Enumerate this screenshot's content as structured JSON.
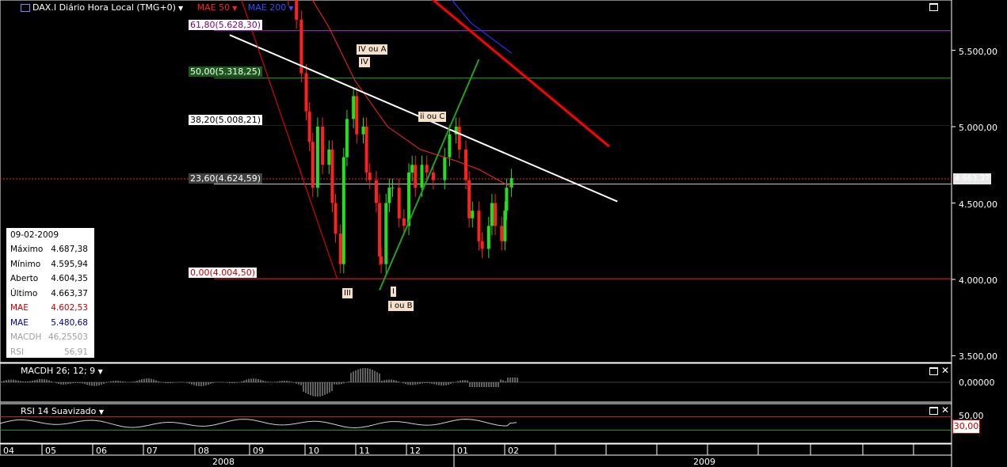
{
  "header": {
    "symbol": "DAX.I Diário Hora Local (TMG+0)",
    "mae50": "MAE 50",
    "mae200": "MAE 200"
  },
  "fib_levels": [
    {
      "label": "61,80(5.628,30)",
      "value": 5628.3,
      "color": "#a040c0"
    },
    {
      "label": "50,00(5.318,25)",
      "value": 5318.25,
      "color": "#20a020"
    },
    {
      "label": "38,20(5.008,21)",
      "value": 5008.21,
      "color": "#ffffff"
    },
    {
      "label": "23,60(4.624,59)",
      "value": 4624.59,
      "color": "#c8c8c8"
    },
    {
      "label": "0,00(4.004,50)",
      "value": 4004.5,
      "color": "#ff2020"
    }
  ],
  "wave_labels": [
    {
      "text": "IV ou A",
      "date": "2008-10-27",
      "value": 5650
    },
    {
      "text": "IV",
      "date": "2008-10-28",
      "value": 5580
    },
    {
      "text": "ii ou C",
      "date": "2009-01-06",
      "value": 5080
    },
    {
      "text": "III",
      "date": "2008-10-25",
      "value": 3940
    },
    {
      "text": "I",
      "date": "2008-11-21",
      "value": 3940
    },
    {
      "text": "i ou B",
      "date": "2008-11-21",
      "value": 3860
    }
  ],
  "price_axis": [
    "5.500,00",
    "5.000,00",
    "4.500,00",
    "4.000,00",
    "3.500,00"
  ],
  "last_price_tag": "4.663,37",
  "info_box": {
    "date": "09-02-2009",
    "rows": [
      {
        "label": "Máximo",
        "value": "4.687,38",
        "color": "#000000"
      },
      {
        "label": "Mínimo",
        "value": "4.595,94",
        "color": "#000000"
      },
      {
        "label": "Aberto",
        "value": "4.604,35",
        "color": "#000000"
      },
      {
        "label": "Último",
        "value": "4.663,37",
        "color": "#000000"
      },
      {
        "label": "MAE",
        "value": "4.602,53",
        "color": "#c00000"
      },
      {
        "label": "MAE",
        "value": "5.480,68",
        "color": "#000080"
      },
      {
        "label": "MACDH",
        "value": "46,25503",
        "color": "#a0a0a0"
      },
      {
        "label": "RSI",
        "value": "56,91",
        "color": "#a0a0a0"
      }
    ]
  },
  "macd_pane": {
    "title": "MACDH 26; 12; 9",
    "axis_label": "0,00000"
  },
  "rsi_pane": {
    "title": "RSI 14 Suavizado",
    "axis_label": "50,00",
    "badge": "30,00"
  },
  "x_axis": {
    "months": [
      "04",
      "05",
      "06",
      "07",
      "08",
      "09",
      "10",
      "11",
      "12",
      "01",
      "02"
    ],
    "years": [
      "2008",
      "2009"
    ]
  },
  "colors": {
    "bull": "#20e020",
    "bear": "#ff2020",
    "mae50": "#ff2020",
    "mae200": "#2030ff",
    "trend_white": "#ffffff",
    "trend_red": "#ff0000",
    "trend_green": "#20a020"
  },
  "chart_data": {
    "type": "candlestick",
    "title": "DAX.I Diário Hora Local (TMG+0)",
    "ylim": [
      3400,
      5900
    ],
    "series_close": [
      {
        "date": "2008-09-15",
        "value": 6050
      },
      {
        "date": "2008-09-25",
        "value": 5850
      },
      {
        "date": "2008-09-30",
        "value": 5700
      },
      {
        "date": "2008-10-03",
        "value": 5350
      },
      {
        "date": "2008-10-06",
        "value": 5100
      },
      {
        "date": "2008-10-08",
        "value": 4900
      },
      {
        "date": "2008-10-10",
        "value": 4600
      },
      {
        "date": "2008-10-13",
        "value": 5000
      },
      {
        "date": "2008-10-16",
        "value": 4750
      },
      {
        "date": "2008-10-20",
        "value": 4850
      },
      {
        "date": "2008-10-22",
        "value": 4500
      },
      {
        "date": "2008-10-24",
        "value": 4300
      },
      {
        "date": "2008-10-27",
        "value": 4100
      },
      {
        "date": "2008-10-29",
        "value": 4800
      },
      {
        "date": "2008-10-31",
        "value": 5050
      },
      {
        "date": "2008-11-04",
        "value": 5200
      },
      {
        "date": "2008-11-06",
        "value": 4950
      },
      {
        "date": "2008-11-10",
        "value": 5000
      },
      {
        "date": "2008-11-12",
        "value": 4700
      },
      {
        "date": "2008-11-14",
        "value": 4650
      },
      {
        "date": "2008-11-18",
        "value": 4500
      },
      {
        "date": "2008-11-20",
        "value": 4150
      },
      {
        "date": "2008-11-21",
        "value": 4100
      },
      {
        "date": "2008-11-24",
        "value": 4500
      },
      {
        "date": "2008-11-26",
        "value": 4600
      },
      {
        "date": "2008-11-28",
        "value": 4600
      },
      {
        "date": "2008-12-02",
        "value": 4400
      },
      {
        "date": "2008-12-05",
        "value": 4350
      },
      {
        "date": "2008-12-08",
        "value": 4700
      },
      {
        "date": "2008-12-10",
        "value": 4750
      },
      {
        "date": "2008-12-12",
        "value": 4600
      },
      {
        "date": "2008-12-16",
        "value": 4750
      },
      {
        "date": "2008-12-19",
        "value": 4700
      },
      {
        "date": "2008-12-23",
        "value": 4650
      },
      {
        "date": "2008-12-30",
        "value": 4800
      },
      {
        "date": "2009-01-02",
        "value": 4950
      },
      {
        "date": "2009-01-06",
        "value": 5000
      },
      {
        "date": "2009-01-08",
        "value": 4850
      },
      {
        "date": "2009-01-12",
        "value": 4650
      },
      {
        "date": "2009-01-14",
        "value": 4400
      },
      {
        "date": "2009-01-16",
        "value": 4450
      },
      {
        "date": "2009-01-20",
        "value": 4250
      },
      {
        "date": "2009-01-22",
        "value": 4200
      },
      {
        "date": "2009-01-26",
        "value": 4350
      },
      {
        "date": "2009-01-28",
        "value": 4500
      },
      {
        "date": "2009-01-30",
        "value": 4350
      },
      {
        "date": "2009-02-03",
        "value": 4250
      },
      {
        "date": "2009-02-05",
        "value": 4450
      },
      {
        "date": "2009-02-06",
        "value": 4600
      },
      {
        "date": "2009-02-09",
        "value": 4663.37
      }
    ],
    "mae50": [
      {
        "date": "2008-08-25",
        "value": 6300
      },
      {
        "date": "2008-09-30",
        "value": 6000
      },
      {
        "date": "2008-10-20",
        "value": 5650
      },
      {
        "date": "2008-11-05",
        "value": 5300
      },
      {
        "date": "2008-11-25",
        "value": 5000
      },
      {
        "date": "2008-12-15",
        "value": 4850
      },
      {
        "date": "2009-01-05",
        "value": 4780
      },
      {
        "date": "2009-01-20",
        "value": 4720
      },
      {
        "date": "2009-02-09",
        "value": 4602.53
      }
    ],
    "mae200": [
      {
        "date": "2008-12-25",
        "value": 5950
      },
      {
        "date": "2009-01-15",
        "value": 5680
      },
      {
        "date": "2009-02-09",
        "value": 5480.68
      }
    ],
    "trendlines": [
      {
        "color": "white",
        "from": {
          "date": "2008-08-20",
          "value": 5600
        },
        "to": {
          "date": "2009-04-15",
          "value": 4510
        }
      },
      {
        "color": "red",
        "from": {
          "date": "2008-12-15",
          "value": 5900
        },
        "to": {
          "date": "2009-04-10",
          "value": 4870
        }
      },
      {
        "color": "green",
        "from": {
          "date": "2008-11-20",
          "value": 3930
        },
        "to": {
          "date": "2009-01-20",
          "value": 5440
        }
      },
      {
        "color": "red",
        "from": {
          "date": "2008-08-25",
          "value": 5900
        },
        "to": {
          "date": "2008-10-25",
          "value": 4004.5
        }
      }
    ],
    "macdh": {
      "ylim": [
        -1,
        1
      ],
      "zero_label": "0,00000"
    },
    "rsi": {
      "levels": [
        70,
        30
      ],
      "ylim": [
        0,
        100
      ]
    }
  }
}
